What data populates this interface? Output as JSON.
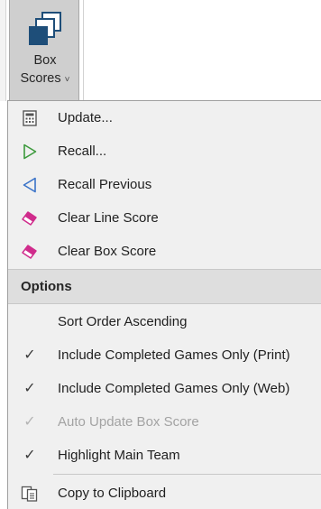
{
  "ribbon": {
    "button_label_line1": "Box",
    "button_label_line2": "Scores",
    "caret": "˅",
    "icon": "box-scores-icon"
  },
  "menu": {
    "items_top": [
      {
        "label": "Update...",
        "icon": "calculator-icon"
      },
      {
        "label": "Recall...",
        "icon": "play-triangle-icon"
      },
      {
        "label": "Recall Previous",
        "icon": "back-triangle-icon"
      },
      {
        "label": "Clear Line Score",
        "icon": "eraser-icon"
      },
      {
        "label": "Clear Box Score",
        "icon": "eraser-icon"
      }
    ],
    "options_header": "Options",
    "options": [
      {
        "label": "Sort Order Ascending",
        "checked": false,
        "enabled": true
      },
      {
        "label": "Include Completed Games Only (Print)",
        "checked": true,
        "enabled": true
      },
      {
        "label": "Include Completed Games Only (Web)",
        "checked": true,
        "enabled": true
      },
      {
        "label": "Auto Update Box Score",
        "checked": true,
        "enabled": false
      },
      {
        "label": "Highlight Main Team",
        "checked": true,
        "enabled": true
      }
    ],
    "check_glyph": "✓",
    "copy_item": {
      "label": "Copy to Clipboard",
      "icon": "clipboard-copy-icon"
    }
  },
  "colors": {
    "accent_dark_blue": "#1e4e79",
    "recall_green": "#3c9a3c",
    "recall_previous_blue": "#3a73c8",
    "eraser_pink": "#d02c8c"
  }
}
